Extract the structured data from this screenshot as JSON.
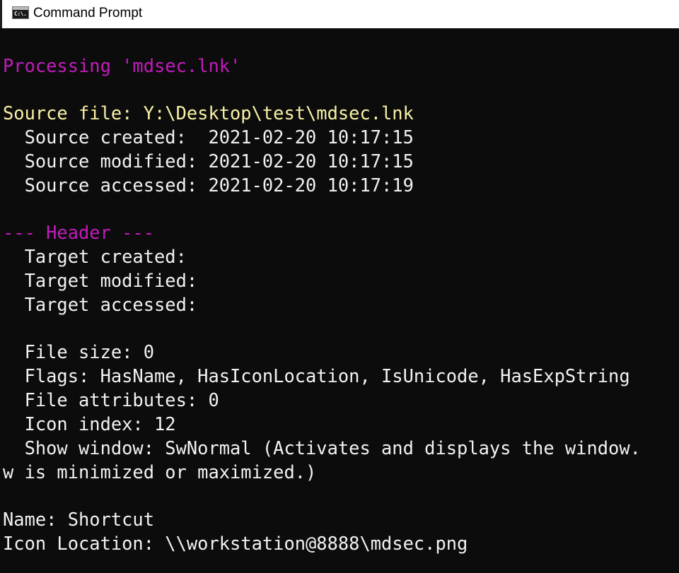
{
  "window": {
    "title": "Command Prompt",
    "icon": "cmd-console-icon",
    "icon_text": "C:\\."
  },
  "colors": {
    "background": "#0c0c0c",
    "default_text": "#f2f2f2",
    "magenta": "#c21bbd",
    "yellow": "#f9f1a5"
  },
  "console": {
    "lines": [
      "Processing 'mdsec.lnk'",
      "",
      "Source file: Y:\\Desktop\\test\\mdsec.lnk",
      "  Source created:  2021-02-20 10:17:15",
      "  Source modified: 2021-02-20 10:17:15",
      "  Source accessed: 2021-02-20 10:17:19",
      "",
      "--- Header ---",
      "  Target created:",
      "  Target modified:",
      "  Target accessed:",
      "",
      "  File size: 0",
      "  Flags: HasName, HasIconLocation, IsUnicode, HasExpString",
      "  File attributes: 0",
      "  Icon index: 12",
      "  Show window: SwNormal (Activates and displays the window.",
      "w is minimized or maximized.)",
      "",
      "Name: Shortcut",
      "Icon Location: \\\\workstation@8888\\mdsec.png"
    ]
  }
}
